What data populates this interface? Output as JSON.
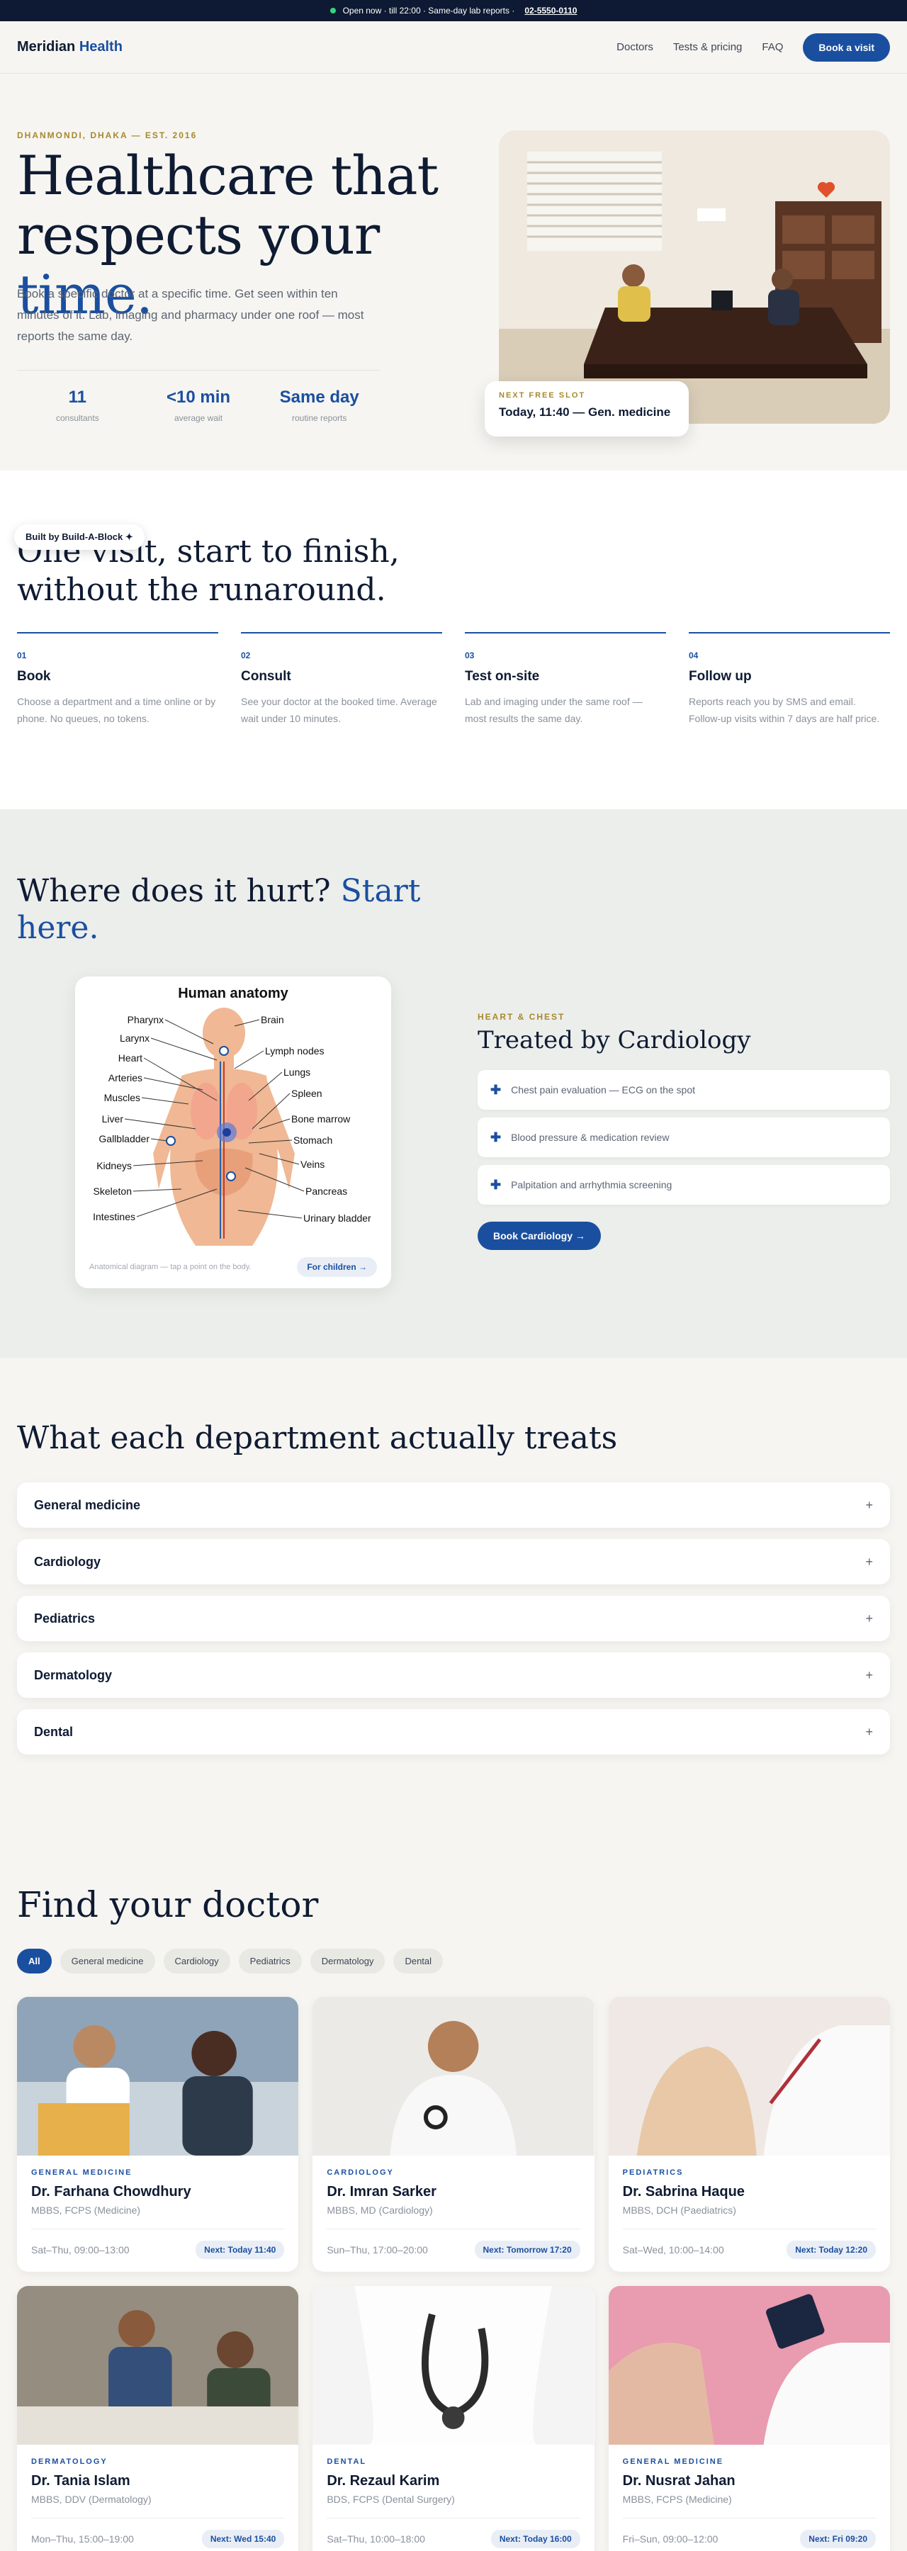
{
  "topbar": {
    "status": "Open now · till 22:00 · Same-day lab reports ·",
    "phone": "02-5550-0110"
  },
  "header": {
    "logo_part1": "Meridian",
    "logo_part2": "Health",
    "nav": [
      "Doctors",
      "Tests & pricing",
      "FAQ"
    ],
    "cta": "Book a visit"
  },
  "hero": {
    "eyebrow": "Dhanmondi, Dhaka — Est. 2016",
    "title_line1": "Healthcare that",
    "title_line2a": "respects your ",
    "title_line2b": "time.",
    "description": "Book a specific doctor at a specific time. Get seen within ten minutes of it. Lab, imaging and pharmacy under one roof — most reports the same day.",
    "stats": [
      {
        "value": "11",
        "label": "consultants"
      },
      {
        "value": "<10 min",
        "label": "average wait"
      },
      {
        "value": "Same day",
        "label": "routine reports"
      }
    ],
    "slot": {
      "eyebrow": "NEXT FREE SLOT",
      "text": "Today, 11:40 — Gen. medicine"
    }
  },
  "badge": "Built by Build-A-Block ✦",
  "process": {
    "title": "One visit, start to finish, without the runaround.",
    "steps": [
      {
        "num": "01",
        "title": "Book",
        "desc": "Choose a department and a time online or by phone. No queues, no tokens."
      },
      {
        "num": "02",
        "title": "Consult",
        "desc": "See your doctor at the booked time. Average wait under 10 minutes."
      },
      {
        "num": "03",
        "title": "Test on-site",
        "desc": "Lab and imaging under the same roof — most results the same day."
      },
      {
        "num": "04",
        "title": "Follow up",
        "desc": "Reports reach you by SMS and email. Follow-up visits within 7 days are half price."
      }
    ]
  },
  "bodymap": {
    "title_part1": "Where does it hurt? ",
    "title_part2": "Start here.",
    "anatomy_title": "Human anatomy",
    "labels_left": [
      "Pharynx",
      "Larynx",
      "Heart",
      "Arteries",
      "Muscles",
      "Liver",
      "Gallbladder",
      "Kidneys",
      "Skeleton",
      "Intestines"
    ],
    "labels_right": [
      "Brain",
      "Lymph nodes",
      "Lungs",
      "Spleen",
      "Bone marrow",
      "Stomach",
      "Veins",
      "Pancreas",
      "Urinary bladder"
    ],
    "caption": "Anatomical diagram — tap a point on the body.",
    "children_pill": "For children →",
    "eyebrow": "HEART & CHEST",
    "dept_title": "Treated by Cardiology",
    "items": [
      "Chest pain evaluation — ECG on the spot",
      "Blood pressure & medication review",
      "Palpitation and arrhythmia screening"
    ],
    "cta": "Book Cardiology →"
  },
  "departments": {
    "title": "What each department actually treats",
    "items": [
      "General medicine",
      "Cardiology",
      "Pediatrics",
      "Dermatology",
      "Dental"
    ],
    "toggle": "+"
  },
  "doctors": {
    "title": "Find your doctor",
    "filters": [
      "All",
      "General medicine",
      "Cardiology",
      "Pediatrics",
      "Dermatology",
      "Dental"
    ],
    "cards": [
      {
        "specialty": "General medicine",
        "name": "Dr. Farhana Chowdhury",
        "degrees": "MBBS, FCPS (Medicine)",
        "hours": "Sat–Thu, 09:00–13:00",
        "next": "Next: Today 11:40"
      },
      {
        "specialty": "Cardiology",
        "name": "Dr. Imran Sarker",
        "degrees": "MBBS, MD (Cardiology)",
        "hours": "Sun–Thu, 17:00–20:00",
        "next": "Next: Tomorrow 17:20"
      },
      {
        "specialty": "Pediatrics",
        "name": "Dr. Sabrina Haque",
        "degrees": "MBBS, DCH (Paediatrics)",
        "hours": "Sat–Wed, 10:00–14:00",
        "next": "Next: Today 12:20"
      },
      {
        "specialty": "Dermatology",
        "name": "Dr. Tania Islam",
        "degrees": "MBBS, DDV (Dermatology)",
        "hours": "Mon–Thu, 15:00–19:00",
        "next": "Next: Wed 15:40"
      },
      {
        "specialty": "Dental",
        "name": "Dr. Rezaul Karim",
        "degrees": "BDS, FCPS (Dental Surgery)",
        "hours": "Sat–Thu, 10:00–18:00",
        "next": "Next: Today 16:00"
      },
      {
        "specialty": "General medicine",
        "name": "Dr. Nusrat Jahan",
        "degrees": "MBBS, FCPS (Medicine)",
        "hours": "Fri–Sun, 09:00–12:00",
        "next": "Next: Fri 09:20"
      }
    ]
  },
  "colors": {
    "accent": "#1a4fa0",
    "navy": "#0e1a33",
    "gold": "#a8882c",
    "status_green": "#37d47a"
  }
}
